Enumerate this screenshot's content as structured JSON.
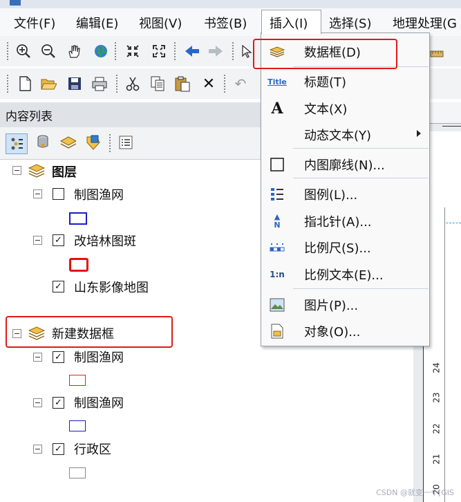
{
  "menubar": {
    "items": [
      "文件(F)",
      "编辑(E)",
      "视图(V)",
      "书签(B)",
      "插入(I)",
      "选择(S)",
      "地理处理(G"
    ]
  },
  "toc": {
    "title": "内容列表",
    "groups": [
      {
        "label": "图层",
        "layers": [
          {
            "label": "制图渔网",
            "checked": false,
            "swatch": "#1a1acc"
          },
          {
            "label": "改培林图斑",
            "checked": true,
            "swatch": "#e81010"
          },
          {
            "label": "山东影像地图",
            "checked": true
          }
        ]
      },
      {
        "label": "新建数据框",
        "layers": [
          {
            "label": "制图渔网",
            "checked": true,
            "swatch": "#e02020"
          },
          {
            "label": "制图渔网",
            "checked": true,
            "swatch": "#1a1acc"
          },
          {
            "label": "行政区",
            "checked": true,
            "swatch": "#888888"
          }
        ]
      }
    ]
  },
  "insert_menu": {
    "items": [
      {
        "label": "数据框(D)",
        "icon": "data-frame-icon"
      },
      {
        "label": "标题(T)",
        "icon": "title-icon",
        "icon_text": "Title"
      },
      {
        "label": "文本(X)",
        "icon": "text-icon",
        "icon_text": "A"
      },
      {
        "label": "动态文本(Y)",
        "icon": "none",
        "submenu": true
      },
      {
        "label": "内图廓线(N)...",
        "icon": "neatline-icon"
      },
      {
        "label": "图例(L)...",
        "icon": "legend-icon"
      },
      {
        "label": "指北针(A)...",
        "icon": "north-arrow-icon",
        "icon_text": "N"
      },
      {
        "label": "比例尺(S)...",
        "icon": "scale-bar-icon"
      },
      {
        "label": "比例文本(E)...",
        "icon": "scale-text-icon",
        "icon_text": "1:n"
      },
      {
        "label": "图片(P)...",
        "icon": "picture-icon"
      },
      {
        "label": "对象(O)...",
        "icon": "object-icon"
      }
    ]
  },
  "ruler": {
    "numbers": [
      "24",
      "23",
      "22",
      "21",
      "20"
    ]
  },
  "watermark": "CSDN @就变一个[GIS",
  "colors": {
    "highlight": "#e01919"
  }
}
